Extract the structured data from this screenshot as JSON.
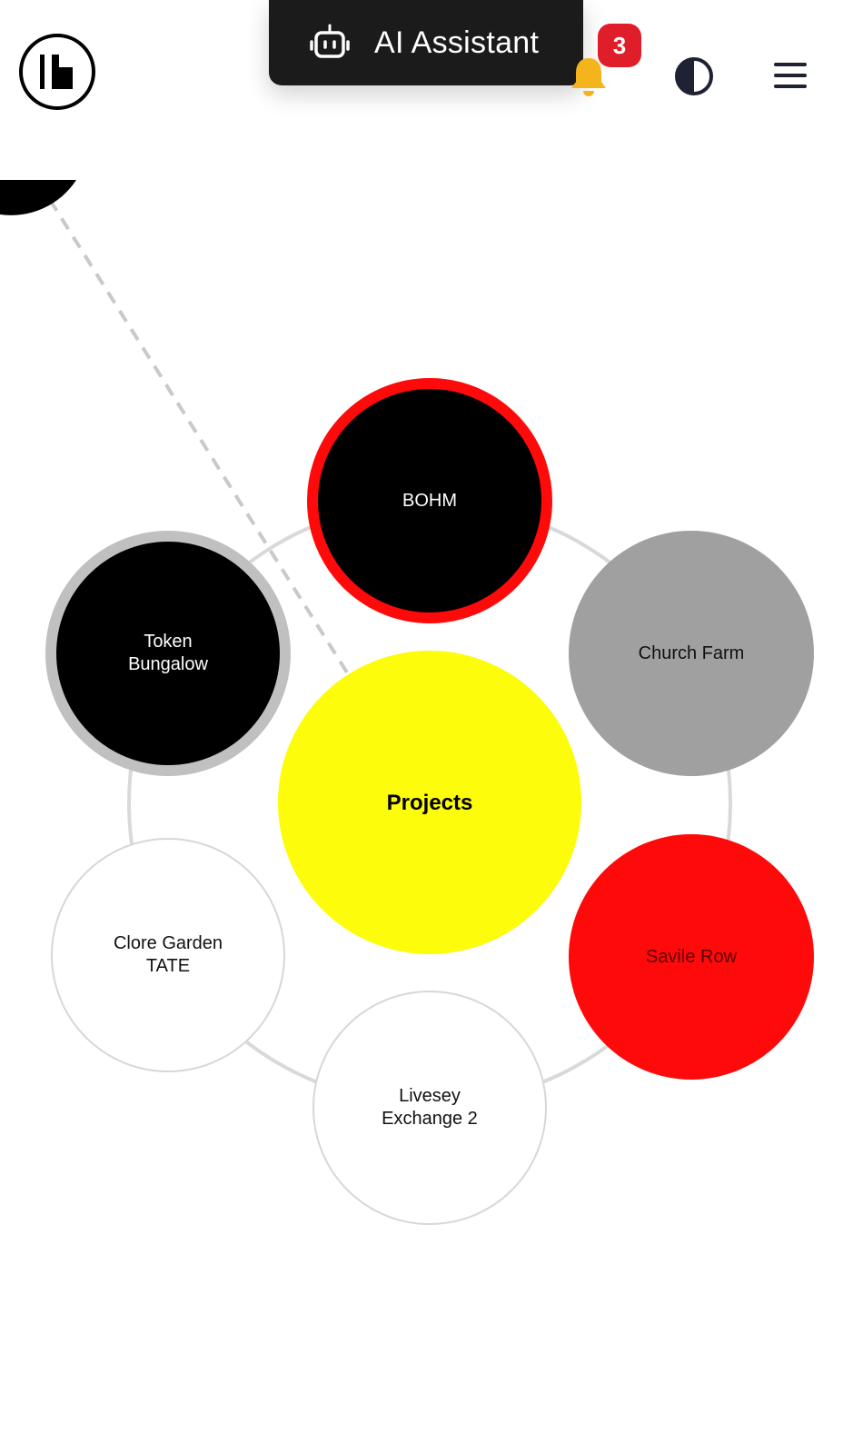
{
  "header": {
    "ai_assistant_label": "AI Assistant",
    "notification_count": "3",
    "icons": {
      "logo": "brand-logo",
      "robot": "robot-icon",
      "bell": "bell-icon",
      "contrast": "contrast-icon",
      "menu": "hamburger-menu-icon"
    },
    "colors": {
      "pill_bg": "#1b1b1b",
      "badge": "#e01e2a",
      "bell": "#f4b51c"
    }
  },
  "graph": {
    "center": {
      "label": "Projects",
      "color": "#fdfc0a"
    },
    "nodes": [
      {
        "id": "bohm",
        "label": "BOHM",
        "fill": "#000000",
        "border": "#ff0a0a"
      },
      {
        "id": "church",
        "label": "Church Farm",
        "fill": "#a0a0a0"
      },
      {
        "id": "token",
        "label": "Token\nBungalow",
        "fill": "#000000",
        "border": "#c0c0c0"
      },
      {
        "id": "clore",
        "label": "Clore Garden\nTATE",
        "fill": "#ffffff",
        "border": "#d7d7d7"
      },
      {
        "id": "savile",
        "label": "Savile Row",
        "fill": "#ff0a0a"
      },
      {
        "id": "livesey",
        "label": "Livesey\nExchange 2",
        "fill": "#ffffff",
        "border": "#d7d7d7"
      }
    ]
  }
}
